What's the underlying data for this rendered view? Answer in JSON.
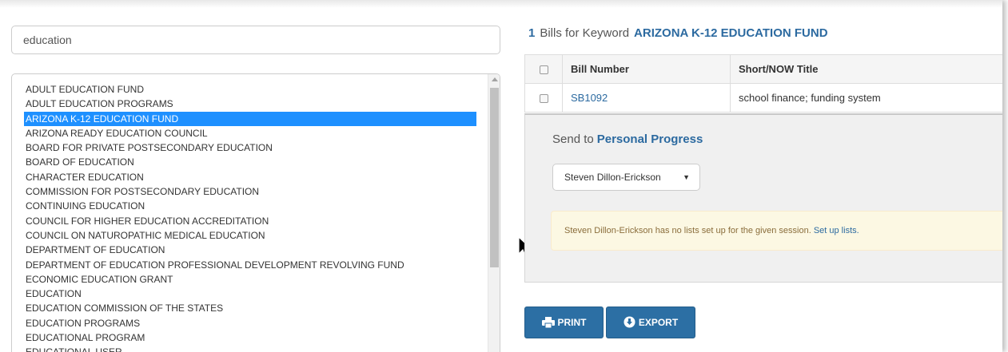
{
  "search": {
    "value": "education"
  },
  "keyword_list": {
    "items": [
      "ADULT EDUCATION FUND",
      "ADULT EDUCATION PROGRAMS",
      "ARIZONA K-12 EDUCATION FUND",
      "ARIZONA READY EDUCATION COUNCIL",
      "BOARD FOR PRIVATE POSTSECONDARY EDUCATION",
      "BOARD OF EDUCATION",
      "CHARACTER EDUCATION",
      "COMMISSION FOR POSTSECONDARY EDUCATION",
      "CONTINUING EDUCATION",
      "COUNCIL FOR HIGHER EDUCATION ACCREDITATION",
      "COUNCIL ON NATUROPATHIC MEDICAL EDUCATION",
      "DEPARTMENT OF EDUCATION",
      "DEPARTMENT OF EDUCATION PROFESSIONAL DEVELOPMENT REVOLVING FUND",
      "ECONOMIC EDUCATION GRANT",
      "EDUCATION",
      "EDUCATION COMMISSION OF THE STATES",
      "EDUCATION PROGRAMS",
      "EDUCATIONAL PROGRAM",
      "EDUCATIONAL USER"
    ],
    "selected": "ARIZONA K-12 EDUCATION FUND"
  },
  "results": {
    "count": "1",
    "label": "Bills for Keyword",
    "keyword": "ARIZONA K-12 EDUCATION FUND"
  },
  "table": {
    "headers": {
      "bill_number": "Bill Number",
      "title": "Short/NOW Title"
    },
    "rows": [
      {
        "bill_number": "SB1092",
        "title": "school finance; funding system"
      }
    ]
  },
  "send": {
    "label": "Send to",
    "target": "Personal Progress",
    "user": "Steven Dillon-Erickson",
    "alert_text": "Steven Dillon-Erickson has no lists set up for the given session.",
    "alert_link": "Set up lists."
  },
  "buttons": {
    "print": "PRINT",
    "export": "EXPORT"
  },
  "colors": {
    "link": "#2c6aa0",
    "selected": "#1e90ff",
    "button": "#2c6fa4",
    "alert_bg": "#fcf8e3"
  }
}
